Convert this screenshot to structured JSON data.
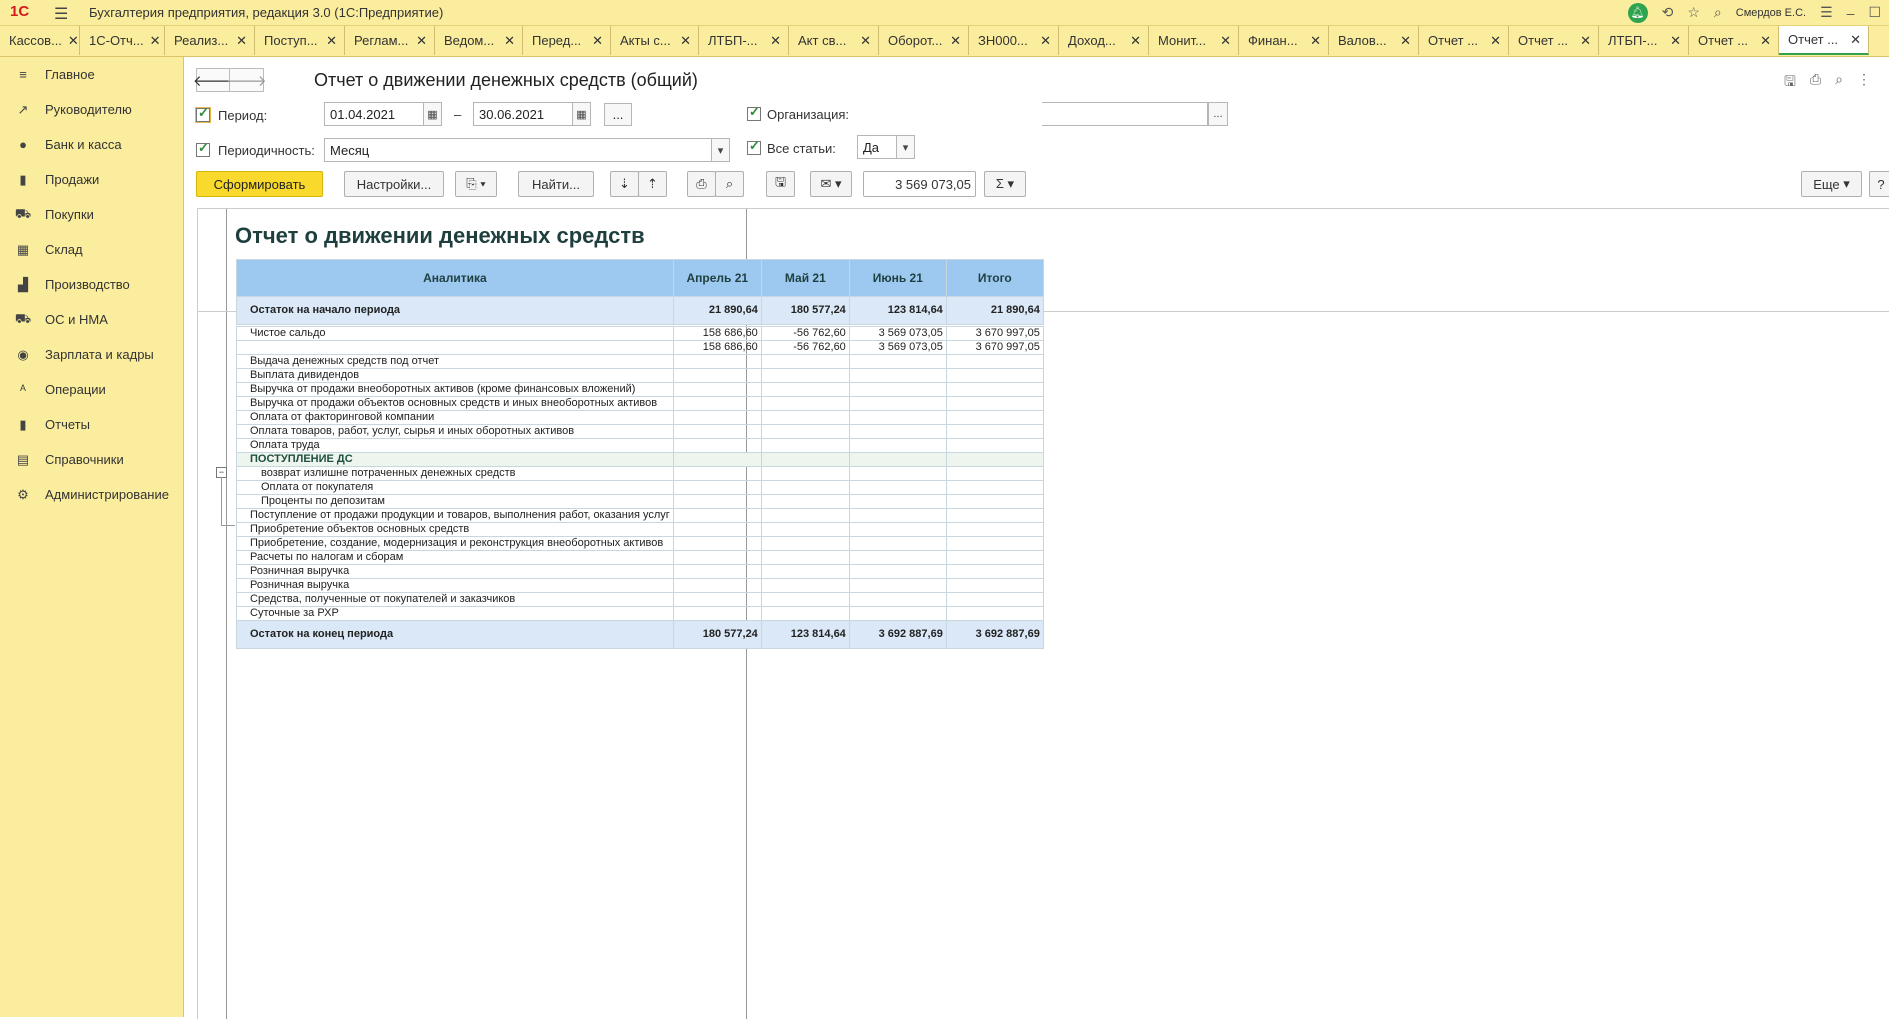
{
  "app": {
    "logo": "1С",
    "title": "Бухгалтерия предприятия, редакция 3.0  (1С:Предприятие)",
    "user": "Смердов Е.С."
  },
  "tabs": [
    {
      "label": "Кассов...",
      "w": 80
    },
    {
      "label": "1С-Отч...",
      "w": 85
    },
    {
      "label": "Реализ...",
      "w": 90
    },
    {
      "label": "Поступ...",
      "w": 90
    },
    {
      "label": "Реглам...",
      "w": 90
    },
    {
      "label": "Ведом...",
      "w": 88
    },
    {
      "label": "Перед...",
      "w": 88
    },
    {
      "label": "Акты с...",
      "w": 88
    },
    {
      "label": "ЛТБП-...",
      "w": 90
    },
    {
      "label": "Акт св...",
      "w": 90
    },
    {
      "label": "Оборот...",
      "w": 90
    },
    {
      "label": "ЗН000...",
      "w": 90
    },
    {
      "label": "Доход...",
      "w": 90
    },
    {
      "label": "Монит...",
      "w": 90
    },
    {
      "label": "Финан...",
      "w": 90
    },
    {
      "label": "Валов...",
      "w": 90
    },
    {
      "label": "Отчет ...",
      "w": 90
    },
    {
      "label": "Отчет ...",
      "w": 90
    },
    {
      "label": "ЛТБП-...",
      "w": 90
    },
    {
      "label": "Отчет ...",
      "w": 90
    },
    {
      "label": "Отчет ...",
      "w": 90
    }
  ],
  "sidebar": [
    {
      "label": "Главное",
      "icon": "≡"
    },
    {
      "label": "Руководителю",
      "icon": "↗"
    },
    {
      "label": "Банк и касса",
      "icon": "●"
    },
    {
      "label": "Продажи",
      "icon": "▮"
    },
    {
      "label": "Покупки",
      "icon": "⛟"
    },
    {
      "label": "Склад",
      "icon": "▦"
    },
    {
      "label": "Производство",
      "icon": "▟"
    },
    {
      "label": "ОС и НМА",
      "icon": "⛟"
    },
    {
      "label": "Зарплата и кадры",
      "icon": "◉"
    },
    {
      "label": "Операции",
      "icon": "ᴬ"
    },
    {
      "label": "Отчеты",
      "icon": "▮"
    },
    {
      "label": "Справочники",
      "icon": "▤"
    },
    {
      "label": "Администрирование",
      "icon": "⚙"
    }
  ],
  "form": {
    "title": "Отчет о движении денежных средств (общий)",
    "period_label": "Период:",
    "period_from": "01.04.2021",
    "period_dash": "–",
    "period_to": "30.06.2021",
    "periodicity_label": "Периодичность:",
    "periodicity_value": "Месяц",
    "org_label": "Организация:",
    "org_value": "",
    "all_items_label": "Все статьи:",
    "all_items_value": "Да",
    "ellipsis": "...",
    "btn_generate": "Сформировать",
    "btn_settings": "Настройки...",
    "btn_find": "Найти...",
    "sum_value": "3 569 073,05",
    "btn_more": "Еще",
    "btn_help": "?"
  },
  "report": {
    "title": "Отчет о движении денежных средств",
    "headers": [
      "Аналитика",
      "Апрель 21",
      "Май 21",
      "Июнь 21",
      "Итого"
    ],
    "opening": {
      "label": "Остаток на начало периода",
      "values": [
        "21 890,64",
        "180 577,24",
        "123 814,64",
        "21 890,64"
      ]
    },
    "rows": [
      {
        "label": "Чистое сальдо",
        "values": [
          "158 686,60",
          "-56 762,60",
          "3 569 073,05",
          "3 670 997,05"
        ]
      },
      {
        "label": "",
        "values": [
          "158 686,60",
          "-56 762,60",
          "3 569 073,05",
          "3 670 997,05"
        ]
      },
      {
        "label": "Выдача денежных средств под отчет",
        "values": [
          "",
          "",
          "",
          ""
        ]
      },
      {
        "label": "Выплата дивидендов",
        "values": [
          "",
          "",
          "",
          ""
        ]
      },
      {
        "label": "Выручка от продажи внеоборотных активов (кроме финансовых вложений)",
        "values": [
          "",
          "",
          "",
          ""
        ]
      },
      {
        "label": "Выручка от продажи объектов основных средств и иных внеоборотных активов",
        "values": [
          "",
          "",
          "",
          ""
        ]
      },
      {
        "label": "Оплата от факторинговой компании",
        "values": [
          "",
          "",
          "",
          ""
        ]
      },
      {
        "label": "Оплата товаров, работ, услуг, сырья и иных оборотных активов",
        "values": [
          "",
          "",
          "",
          ""
        ]
      },
      {
        "label": "Оплата труда",
        "values": [
          "",
          "",
          "",
          ""
        ]
      },
      {
        "label": "ПОСТУПЛЕНИЕ ДС",
        "values": [
          "",
          "",
          "",
          ""
        ],
        "group": true
      },
      {
        "label": "возврат излишне потраченных денежных средств",
        "values": [
          "",
          "",
          "",
          ""
        ],
        "indent": true
      },
      {
        "label": "Оплата от покупателя",
        "values": [
          "",
          "",
          "",
          ""
        ],
        "indent": true
      },
      {
        "label": "Проценты по депозитам",
        "values": [
          "",
          "",
          "",
          ""
        ],
        "indent": true
      },
      {
        "label": "Поступление от продажи продукции и товаров, выполнения работ, оказания услуг",
        "values": [
          "",
          "",
          "",
          ""
        ]
      },
      {
        "label": "Приобретение объектов основных средств",
        "values": [
          "",
          "",
          "",
          ""
        ]
      },
      {
        "label": "Приобретение, создание, модернизация и реконструкция внеоборотных активов",
        "values": [
          "",
          "",
          "",
          ""
        ]
      },
      {
        "label": "Расчеты по налогам и сборам",
        "values": [
          "",
          "",
          "",
          ""
        ]
      },
      {
        "label": "Розничная выручка",
        "values": [
          "",
          "",
          "",
          ""
        ]
      },
      {
        "label": "Розничная выручка",
        "values": [
          "",
          "",
          "",
          ""
        ]
      },
      {
        "label": "Средства, полученные от покупателей и заказчиков",
        "values": [
          "",
          "",
          "",
          ""
        ]
      },
      {
        "label": "Суточные за РХР",
        "values": [
          "",
          "",
          "",
          ""
        ]
      }
    ],
    "closing": {
      "label": "Остаток на конец периода",
      "values": [
        "180 577,24",
        "123 814,64",
        "3 692 887,69",
        "3 692 887,69"
      ]
    }
  }
}
